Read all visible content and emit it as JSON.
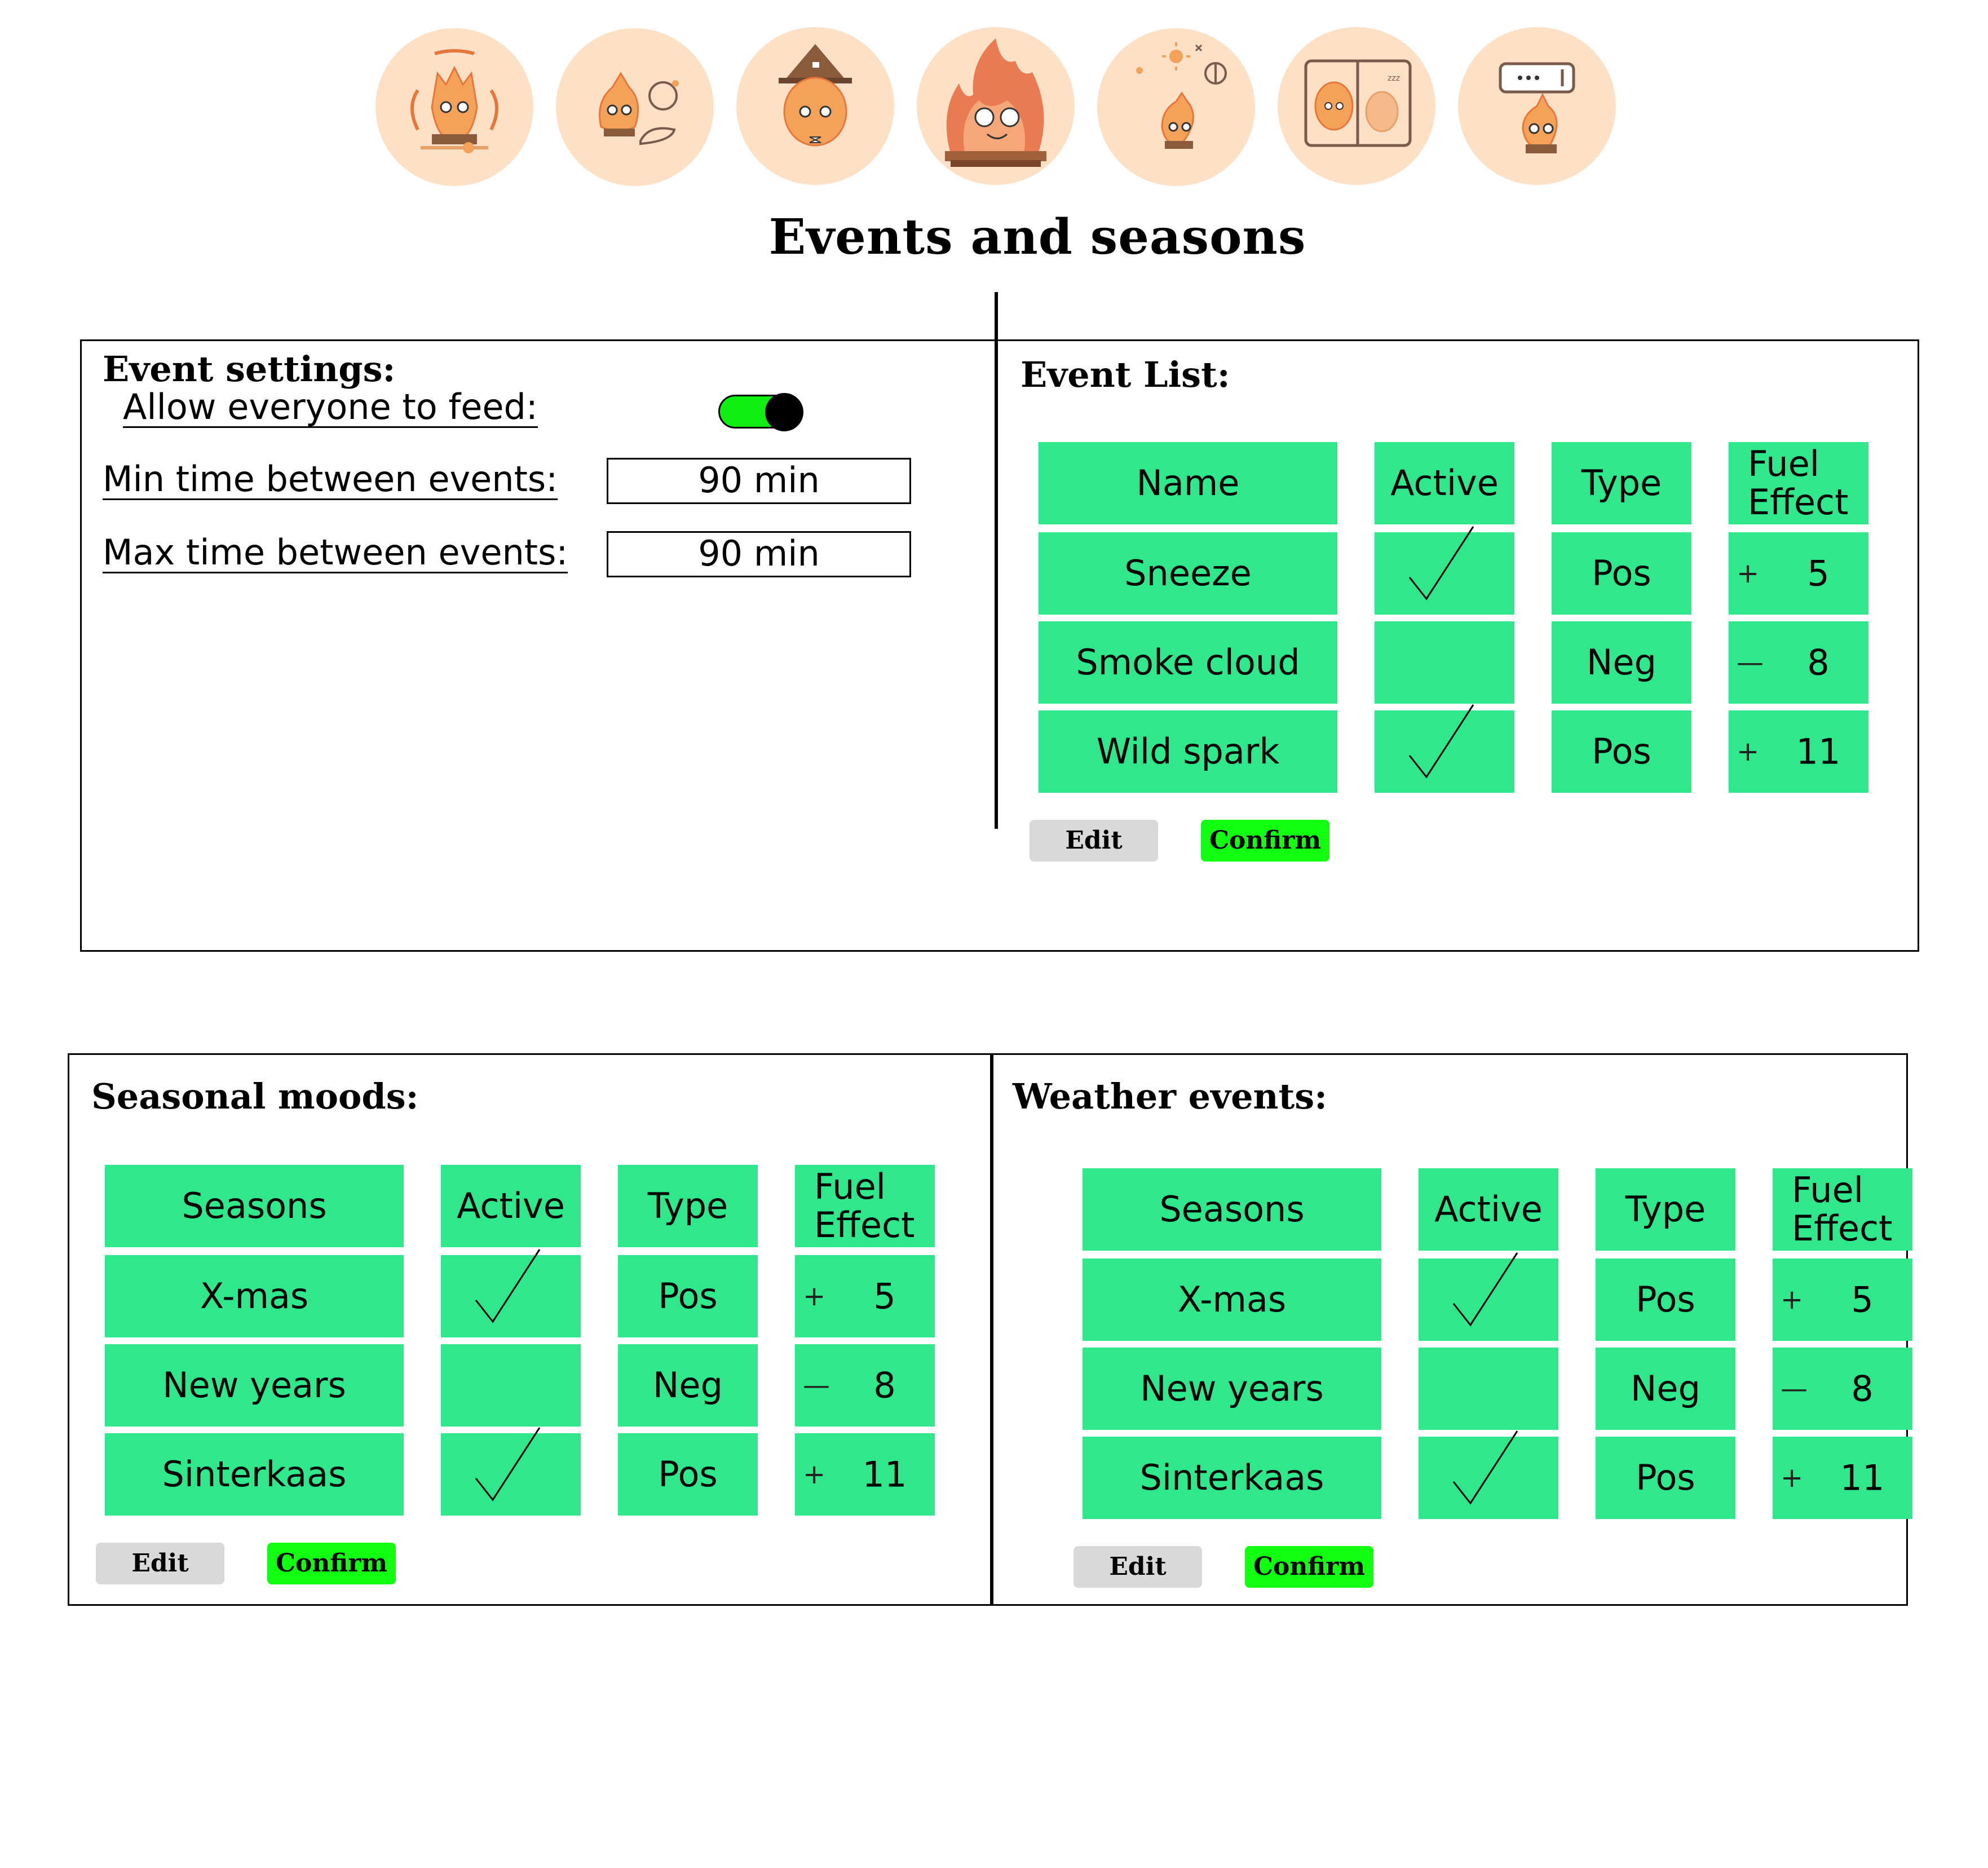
{
  "header": {
    "icons": [
      {
        "name": "calcifer-aura-icon"
      },
      {
        "name": "calcifer-food-icon"
      },
      {
        "name": "calcifer-witch-hat-icon"
      },
      {
        "name": "calcifer-fire-icon"
      },
      {
        "name": "calcifer-weather-icon"
      },
      {
        "name": "calcifer-sleep-icon"
      },
      {
        "name": "calcifer-message-icon"
      }
    ],
    "title": "Events and seasons"
  },
  "event_settings": {
    "title": "Event settings:",
    "allow_feed_label": "Allow everyone to feed:",
    "allow_feed_on": true,
    "min_time_label": "Min time between events:",
    "min_time_value": "90 min",
    "max_time_label": "Max time between events:",
    "max_time_value": "90 min"
  },
  "event_list": {
    "title": "Event List:",
    "headers": [
      "Name",
      "Active",
      "Type",
      "Fuel Effect"
    ],
    "rows": [
      {
        "name": "Sneeze",
        "active": true,
        "type": "Pos",
        "sign": "+",
        "fuel": "5"
      },
      {
        "name": "Smoke cloud",
        "active": false,
        "type": "Neg",
        "sign": "—",
        "fuel": "8"
      },
      {
        "name": "Wild spark",
        "active": true,
        "type": "Pos",
        "sign": "+",
        "fuel": "11"
      }
    ],
    "edit_label": "Edit",
    "confirm_label": "Confirm"
  },
  "seasonal_moods": {
    "title": "Seasonal moods:",
    "headers": [
      "Seasons",
      "Active",
      "Type",
      "Fuel Effect"
    ],
    "rows": [
      {
        "name": "X-mas",
        "active": true,
        "type": "Pos",
        "sign": "+",
        "fuel": "5"
      },
      {
        "name": "New years",
        "active": false,
        "type": "Neg",
        "sign": "—",
        "fuel": "8"
      },
      {
        "name": "Sinterkaas",
        "active": true,
        "type": "Pos",
        "sign": "+",
        "fuel": "11"
      }
    ],
    "edit_label": "Edit",
    "confirm_label": "Confirm"
  },
  "weather_events": {
    "title": "Weather events:",
    "headers": [
      "Seasons",
      "Active",
      "Type",
      "Fuel Effect"
    ],
    "rows": [
      {
        "name": "X-mas",
        "active": true,
        "type": "Pos",
        "sign": "+",
        "fuel": "5"
      },
      {
        "name": "New years",
        "active": false,
        "type": "Neg",
        "sign": "—",
        "fuel": "8"
      },
      {
        "name": "Sinterkaas",
        "active": true,
        "type": "Pos",
        "sign": "+",
        "fuel": "11"
      }
    ],
    "edit_label": "Edit",
    "confirm_label": "Confirm"
  },
  "colors": {
    "cell_green": "#30e88c",
    "confirm_green": "#11ff11",
    "edit_grey": "#d9d9d9",
    "icon_bg": "#fde1c6",
    "flame_orange": "#f4a15a"
  }
}
